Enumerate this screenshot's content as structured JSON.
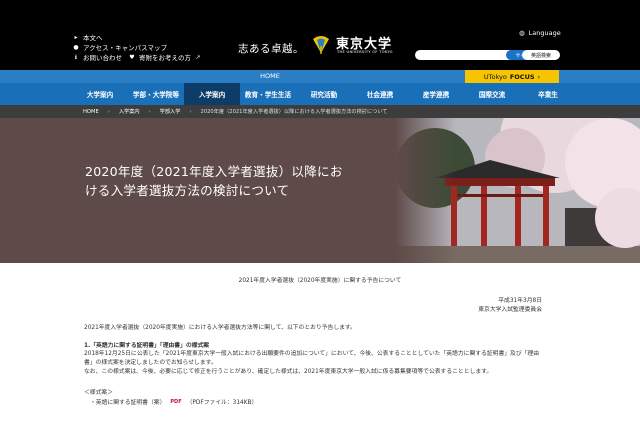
{
  "header": {
    "util_links": [
      {
        "label": "本文へ",
        "icon": "arrow-right-icon"
      },
      {
        "label": "アクセス・キャンパスマップ",
        "icon": "location-pin-icon"
      },
      {
        "label": "お問い合わせ",
        "icon": "info-icon"
      },
      {
        "label": "寄附をお考えの方",
        "icon": "donate-icon"
      }
    ],
    "tagline": "志ある卓越。",
    "logo_name": "東京大学",
    "logo_sub": "THE UNIVERSITY OF TOKYO",
    "language_label": "Language",
    "search_button": "サイト内検索",
    "english_button": "英語検索"
  },
  "strip": {
    "home": "HOME",
    "focus_prefix": "UTokyo",
    "focus_bold": "FOCUS",
    "focus_arrow": "›"
  },
  "nav": {
    "items": [
      {
        "label": "大学案内",
        "active": false
      },
      {
        "label": "学部・大学院等",
        "active": false
      },
      {
        "label": "入学案内",
        "active": true
      },
      {
        "label": "教育・学生生活",
        "active": false
      },
      {
        "label": "研究活動",
        "active": false
      },
      {
        "label": "社会連携",
        "active": false
      },
      {
        "label": "産学連携",
        "active": false
      },
      {
        "label": "国際交流",
        "active": false
      },
      {
        "label": "卒業生",
        "active": false
      }
    ]
  },
  "breadcrumb": [
    "HOME",
    "入学案内",
    "学部入学",
    "2020年度（2021年度入学者選抜）以降における入学者選抜方法の検討について"
  ],
  "hero": {
    "title": "2020年度（2021年度入学者選抜）以降における入学者選抜方法の検討について"
  },
  "content": {
    "notice_title": "2021年度入学者選抜（2020年度実施）に関する予告について",
    "date": "平成31年3月8日",
    "org": "東京大学入試監理委員会",
    "intro": "2021年度入学者選抜（2020年度実施）における入学者選抜方法等に関して、以下のとおり予告します。",
    "section_heading": "1.「英語力に関する証明書」「理由書」の様式案",
    "para_lines": [
      "2018年12月25日に公表した「2021年度東京大学一般入試における出願要件の追加について」において、今後、公表することとしていた「英語力に関する証明書」及び「理由",
      "書」の様式案を決定しましたのでお知らせします。",
      "なお、この様式案は、今後、必要に応じて修正を行うことがあり、確定した様式は、2021年度東京大学一般入試に係る募集要項等で公表することとします。"
    ],
    "sample_heading": "＜様式案＞",
    "sample_link": "・英語に関する証明書（案）",
    "pdf_label": "PDF",
    "pdf_info": "（PDFファイル：314KB）"
  },
  "colors": {
    "header_bg": "#000000",
    "nav_blue": "#1a70b8",
    "nav_active": "#0d3c66",
    "focus_yellow": "#f6c400",
    "hero_bg": "#5e4a48"
  }
}
